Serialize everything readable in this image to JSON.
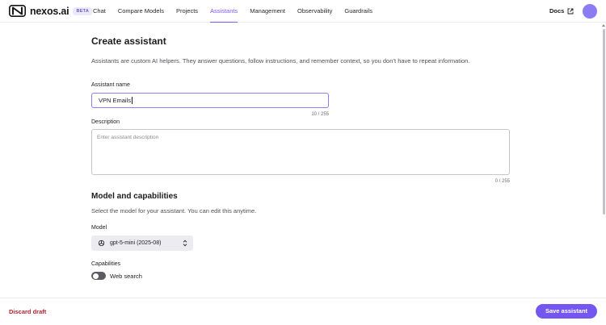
{
  "header": {
    "brand": "nexos.ai",
    "beta_badge": "BETA",
    "nav": [
      {
        "label": "Chat"
      },
      {
        "label": "Compare Models"
      },
      {
        "label": "Projects"
      },
      {
        "label": "Assistants",
        "active": true
      },
      {
        "label": "Management"
      },
      {
        "label": "Observability"
      },
      {
        "label": "Guardrails"
      }
    ],
    "docs_label": "Docs",
    "accent_color": "#7a5af8"
  },
  "main": {
    "title": "Create assistant",
    "intro": "Assistants are custom AI helpers. They answer questions, follow instructions, and remember context, so you don’t have to repeat information.",
    "name_field": {
      "label": "Assistant name",
      "value": "VPN Emails",
      "counter": "10 / 255"
    },
    "description_field": {
      "label": "Description",
      "placeholder": "Enter assistant description",
      "counter": "0 / 255"
    },
    "model_section": {
      "title": "Model and capabilities",
      "description": "Select the model for your assistant. You can edit this anytime.",
      "model_label": "Model",
      "model_value": "gpt-5-mini (2025-08)",
      "capabilities_label": "Capabilities",
      "web_search_label": "Web search",
      "web_search_enabled": false
    }
  },
  "footer": {
    "discard_label": "Discard draft",
    "save_label": "Save assistant",
    "discard_color": "#b4232f",
    "save_color": "#7357f0"
  }
}
